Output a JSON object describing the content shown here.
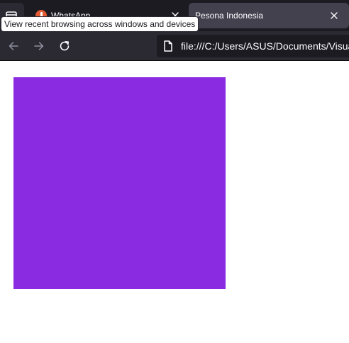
{
  "tabs": [
    {
      "title": "WhatsApp",
      "favicon": "whatsapp-icon",
      "active": false
    },
    {
      "title": "Pesona Indonesia",
      "active": true
    }
  ],
  "tooltip": {
    "text": "View recent browsing across windows and devices"
  },
  "toolbar": {
    "back_icon": "arrow-left-icon",
    "forward_icon": "arrow-right-icon",
    "reload_icon": "reload-icon"
  },
  "urlbar": {
    "url": "file:///C:/Users/ASUS/Documents/Visua"
  },
  "content": {
    "box_color": "#8a2be2"
  },
  "colors": {
    "tabstrip_bg": "#1c1b22",
    "toolbar_bg": "#2b2a33",
    "active_tab_bg": "#42414d"
  }
}
